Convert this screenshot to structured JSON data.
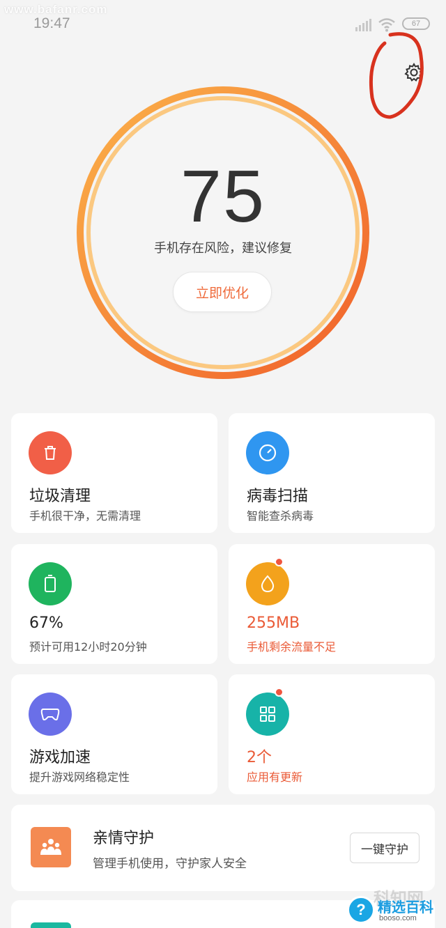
{
  "status_bar": {
    "time": "19:47",
    "battery": "67"
  },
  "watermarks": {
    "top": "www.bafanr.com",
    "bottom_title": "精选百科",
    "bottom_url": "booso.com",
    "bottom_faded": "科知网"
  },
  "score": {
    "value": "75",
    "message": "手机存在风险，建议修复",
    "button_label": "立即优化"
  },
  "cards": [
    {
      "title": "垃圾清理",
      "subtitle": "手机很干净，无需清理",
      "icon": "trash-icon",
      "color": "#f15f47"
    },
    {
      "title": "病毒扫描",
      "subtitle": "智能查杀病毒",
      "icon": "gauge-icon",
      "color": "#2f96f0"
    },
    {
      "title": "67%",
      "subtitle": "预计可用12小时20分钟",
      "icon": "battery-icon",
      "color": "#1fb45e"
    },
    {
      "title": "255MB",
      "subtitle": "手机剩余流量不足",
      "icon": "data-drop-icon",
      "color": "#f3a21c"
    },
    {
      "title": "游戏加速",
      "subtitle": "提升游戏网络稳定性",
      "icon": "gamepad-icon",
      "color": "#6a6fe8"
    },
    {
      "title": "2个",
      "subtitle": "应用有更新",
      "icon": "apps-grid-icon",
      "color": "#17b3a8"
    }
  ],
  "family_guard": {
    "title": "亲情守护",
    "subtitle": "管理手机使用，守护家人安全",
    "button_label": "一键守护"
  },
  "colors": {
    "accent": "#ef6a3a",
    "ring_outer": "#f27a33",
    "ring_inner": "#fbc06b",
    "alert": "#ea5a36"
  }
}
